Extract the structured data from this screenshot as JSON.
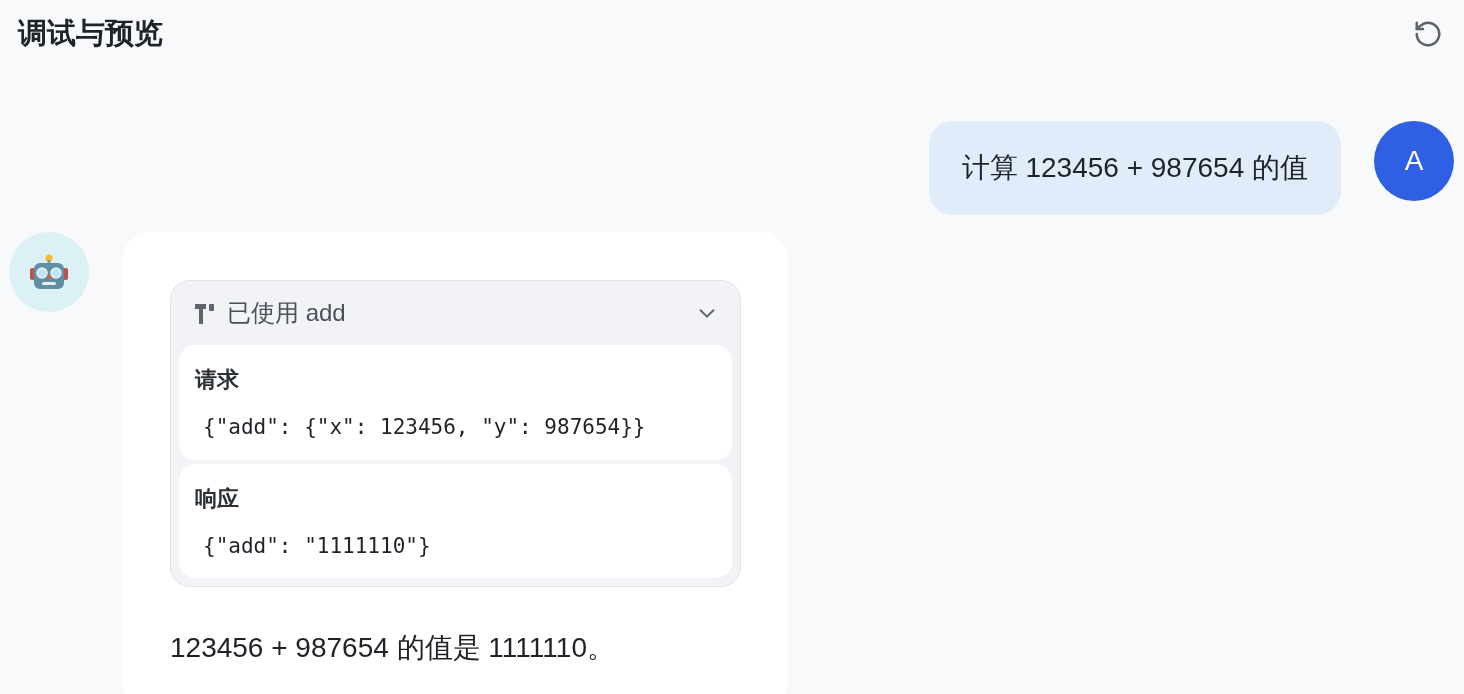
{
  "header": {
    "title": "调试与预览"
  },
  "messages": [
    {
      "kind": "user",
      "avatar": "A",
      "text": "计算 123456 + 987654 的值"
    },
    {
      "kind": "assistant",
      "tool_call": {
        "label": "已使用 add",
        "expanded": true,
        "sections": [
          {
            "title": "请求",
            "body": "{\"add\": {\"x\": 123456, \"y\": 987654}}"
          },
          {
            "title": "响应",
            "body": "{\"add\": \"1111110\"}"
          }
        ]
      },
      "text": "123456 + 987654 的值是 1111110。"
    }
  ]
}
